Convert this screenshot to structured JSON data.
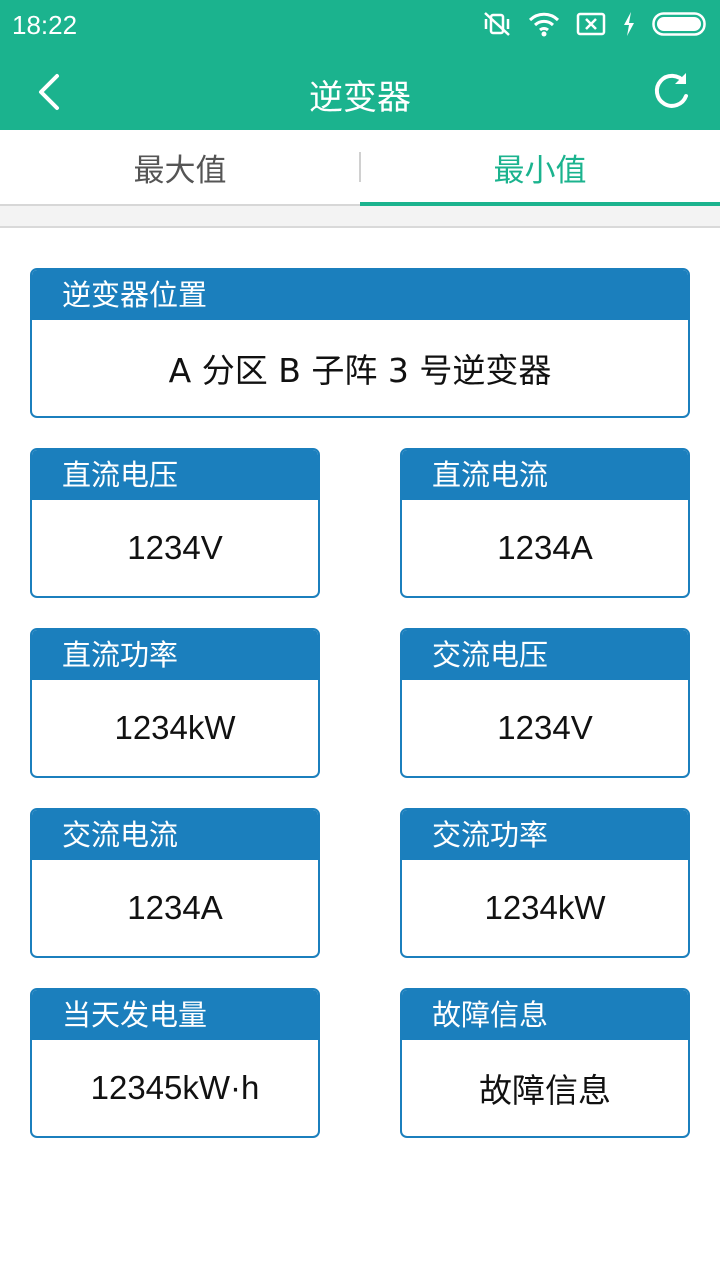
{
  "status_bar": {
    "time": "18:22",
    "icons": [
      "mute-vibrate-icon",
      "wifi-icon",
      "sim-off-icon",
      "charging-icon",
      "battery-icon"
    ]
  },
  "app_bar": {
    "title": "逆变器",
    "back_icon": "chevron-left-icon",
    "refresh_icon": "refresh-icon"
  },
  "tabs": [
    {
      "label": "最大值",
      "active": false
    },
    {
      "label": "最小值",
      "active": true
    }
  ],
  "location": {
    "label": "逆变器位置",
    "value": "A 分区 B 子阵 3 号逆变器"
  },
  "metrics": [
    {
      "label": "直流电压",
      "value": "1234V"
    },
    {
      "label": "直流电流",
      "value": "1234A"
    },
    {
      "label": "直流功率",
      "value": "1234kW"
    },
    {
      "label": "交流电压",
      "value": "1234V"
    },
    {
      "label": "交流电流",
      "value": "1234A"
    },
    {
      "label": "交流功率",
      "value": "1234kW"
    },
    {
      "label": "当天发电量",
      "value": "12345kW·h"
    },
    {
      "label": "故障信息",
      "value": "故障信息"
    }
  ],
  "colors": {
    "primary_green": "#1bb38e",
    "card_blue": "#1b7fbd"
  }
}
